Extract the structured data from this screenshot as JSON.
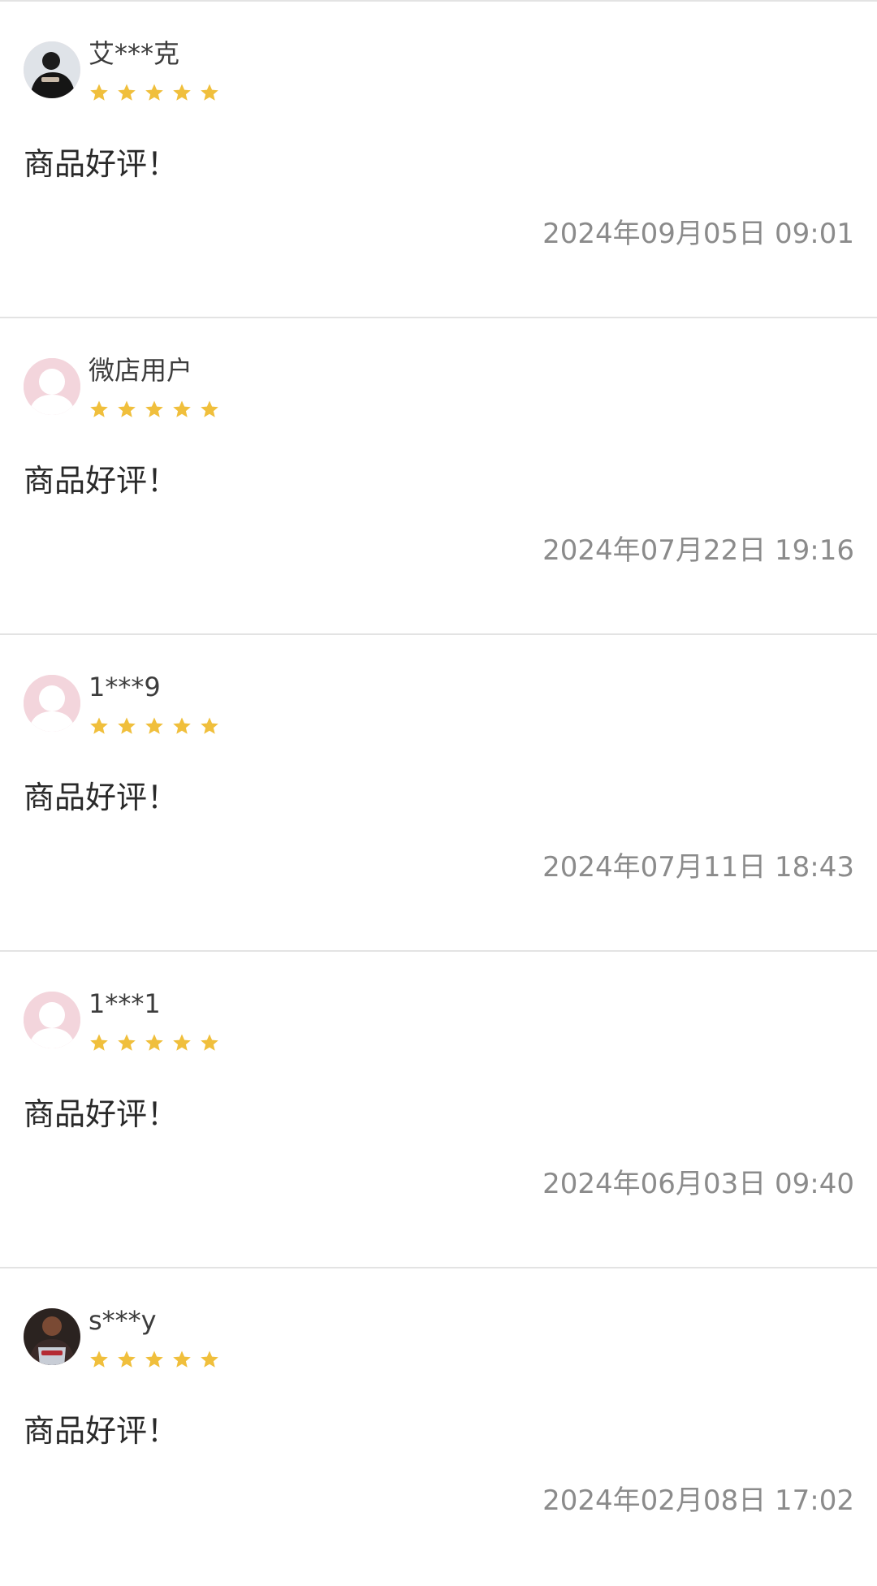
{
  "reviews": [
    {
      "username": "艾***克",
      "avatar": "photo-avatar-dark",
      "rating": 5,
      "content": "商品好评！",
      "time": "2024年09月05日 09:01"
    },
    {
      "username": "微店用户",
      "avatar": "default-avatar",
      "rating": 5,
      "content": "商品好评！",
      "time": "2024年07月22日 19:16"
    },
    {
      "username": "1***9",
      "avatar": "default-avatar",
      "rating": 5,
      "content": "商品好评！",
      "time": "2024年07月11日 18:43"
    },
    {
      "username": "1***1",
      "avatar": "default-avatar",
      "rating": 5,
      "content": "商品好评！",
      "time": "2024年06月03日 09:40"
    },
    {
      "username": "s***y",
      "avatar": "photo-avatar-basketball",
      "rating": 5,
      "content": "商品好评！",
      "time": "2024年02月08日 17:02"
    }
  ],
  "colors": {
    "star": "#f0bf3c",
    "divider": "#e3e3e3",
    "default_avatar": "#f3d5dc",
    "timestamp": "#8b8b8b"
  }
}
